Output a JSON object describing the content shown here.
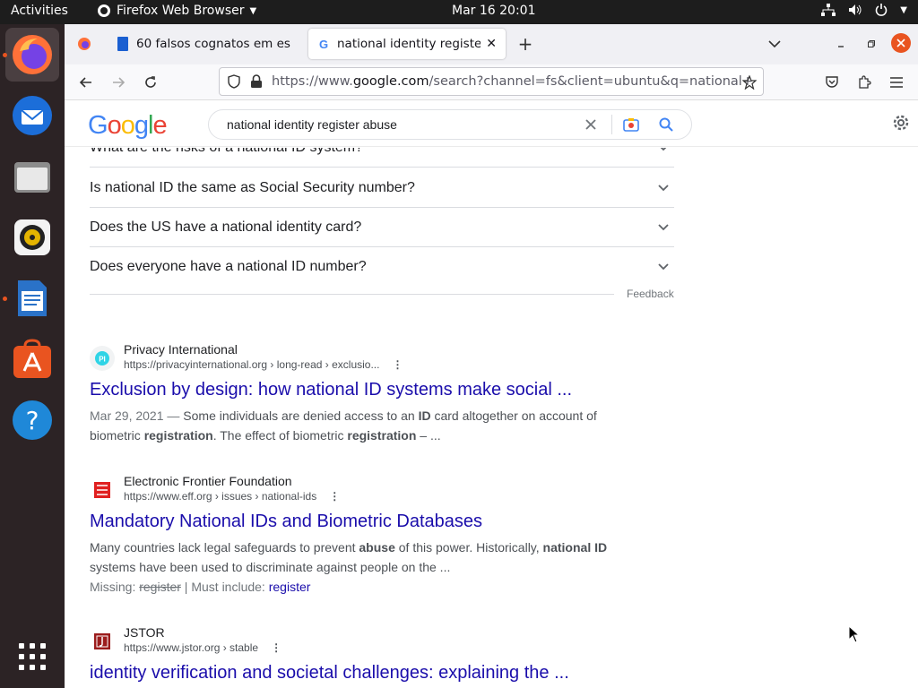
{
  "topbar": {
    "activities": "Activities",
    "app_name": "Firefox Web Browser",
    "clock": "Mar 16  20:01"
  },
  "tabs": [
    {
      "label": "60 falsos cognatos em es"
    },
    {
      "label": "national identity register"
    }
  ],
  "navbar": {
    "url_prefix": "https://www.",
    "url_host": "google.com",
    "url_rest": "/search?channel=fs&client=ubuntu&q=national+"
  },
  "google": {
    "logo": [
      "G",
      "o",
      "o",
      "g",
      "l",
      "e"
    ],
    "logo_colors": [
      "#4285f4",
      "#ea4335",
      "#fbbc05",
      "#4285f4",
      "#34a853",
      "#ea4335"
    ],
    "query": "national identity register abuse"
  },
  "paa": {
    "items": [
      "What are the risks of a national ID system?",
      "Is national ID the same as Social Security number?",
      "Does the US have a national identity card?",
      "Does everyone have a national ID number?"
    ],
    "feedback": "Feedback"
  },
  "results": [
    {
      "site": "Privacy International",
      "url": "https://privacyinternational.org › long-read › exclusio...",
      "title": "Exclusion by design: how national ID systems make social ...",
      "date": "Mar 29, 2021 — ",
      "snippet_parts": [
        "Some individuals are denied access to an ",
        "ID",
        " card altogether on account of biometric ",
        "registration",
        ". The effect of biometric ",
        "registration",
        " – ..."
      ]
    },
    {
      "site": "Electronic Frontier Foundation",
      "url": "https://www.eff.org › issues › national-ids",
      "title": "Mandatory National IDs and Biometric Databases",
      "snippet_parts": [
        "Many countries lack legal safeguards to prevent ",
        "abuse",
        " of this power. Historically, ",
        "national ID",
        " systems have been used to discriminate against people on the ..."
      ],
      "missing_label": "Missing: ",
      "missing_term": "register",
      "must_include_label": " | Must include: ",
      "must_include_term": "register"
    },
    {
      "site": "JSTOR",
      "url": "https://www.jstor.org › stable",
      "title": "identity verification and societal challenges: explaining the ..."
    }
  ],
  "colors": {
    "link": "#1a0dab",
    "accent": "#e95420"
  }
}
